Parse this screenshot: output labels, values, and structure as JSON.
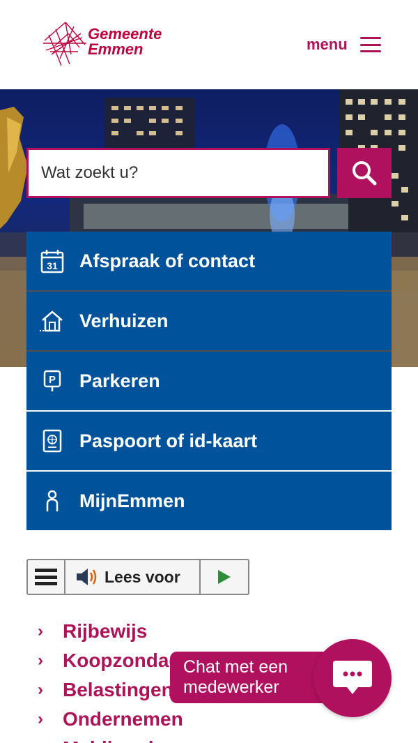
{
  "header": {
    "logo_line1": "Gemeente",
    "logo_line2": "Emmen",
    "menu_label": "menu"
  },
  "search": {
    "placeholder": "Wat zoekt u?"
  },
  "quick_nav": [
    {
      "label": "Afspraak of contact",
      "icon": "calendar-icon",
      "calendar_day": "31"
    },
    {
      "label": "Verhuizen",
      "icon": "house-icon"
    },
    {
      "label": "Parkeren",
      "icon": "parking-icon",
      "parking_letter": "P"
    },
    {
      "label": "Paspoort of id-kaart",
      "icon": "passport-icon"
    },
    {
      "label": "MijnEmmen",
      "icon": "person-icon"
    }
  ],
  "readspeaker": {
    "listen_label": "Lees voor"
  },
  "links": [
    {
      "label": "Rijbewijs"
    },
    {
      "label": "Koopzondagen"
    },
    {
      "label": "Belastingen"
    },
    {
      "label": "Ondernemen"
    },
    {
      "label": "Melding doen"
    }
  ],
  "chat": {
    "line1": "Chat met een",
    "line2": "medewerker"
  },
  "colors": {
    "brand": "#b0115e",
    "link": "#ad1457",
    "tile": "#00529b"
  }
}
